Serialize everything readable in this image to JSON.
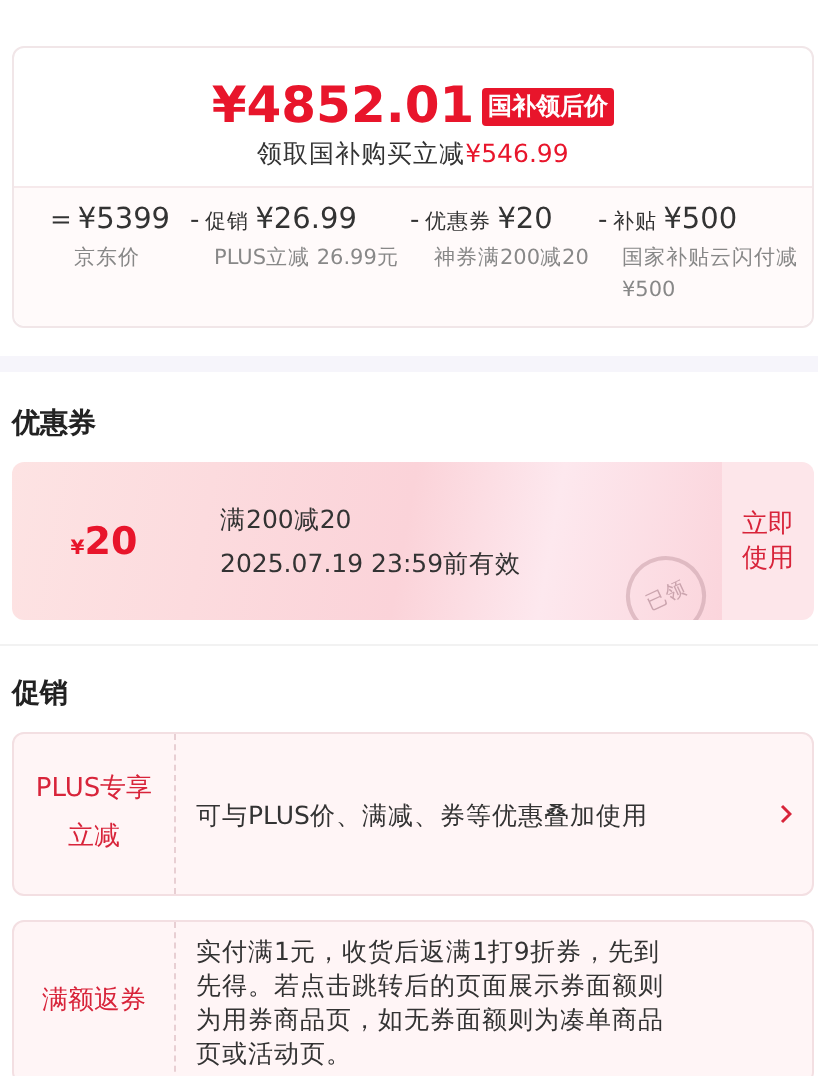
{
  "price_card": {
    "price": "¥4852.01",
    "badge": "国补领后价",
    "subtitle": "领取国补购买立减",
    "saving": "¥546.99",
    "breakdown": [
      {
        "op": "=",
        "amount": "¥5399",
        "note": "京东价"
      },
      {
        "op": "-",
        "label": "促销",
        "amount": "¥26.99",
        "note": "PLUS立减 26.99元"
      },
      {
        "op": "-",
        "label": "优惠券",
        "amount": "¥20",
        "note": "神券满200减20"
      },
      {
        "op": "-",
        "label": "补贴",
        "amount": "¥500",
        "note": "国家补贴云闪付减¥500"
      }
    ]
  },
  "coupon_section": {
    "heading": "优惠券",
    "coupons": [
      {
        "currency": "¥",
        "amount": "20",
        "condition": "满200减20",
        "validity": "2025.07.19 23:59前有效",
        "stamp": "已领",
        "action": "立即使用"
      }
    ]
  },
  "promo_section": {
    "heading": "促销",
    "promotions": [
      {
        "label": "PLUS专享立减",
        "description": "可与PLUS价、满减、券等优惠叠加使用",
        "arrow": true
      },
      {
        "label": "满额返券",
        "description": "实付满1元，收货后返满1打9折券，先到先得。若点击跳转后的页面展示券面额则为用券商品页，如无券面额则为凑单商品页或活动页。",
        "arrow": false
      }
    ]
  }
}
